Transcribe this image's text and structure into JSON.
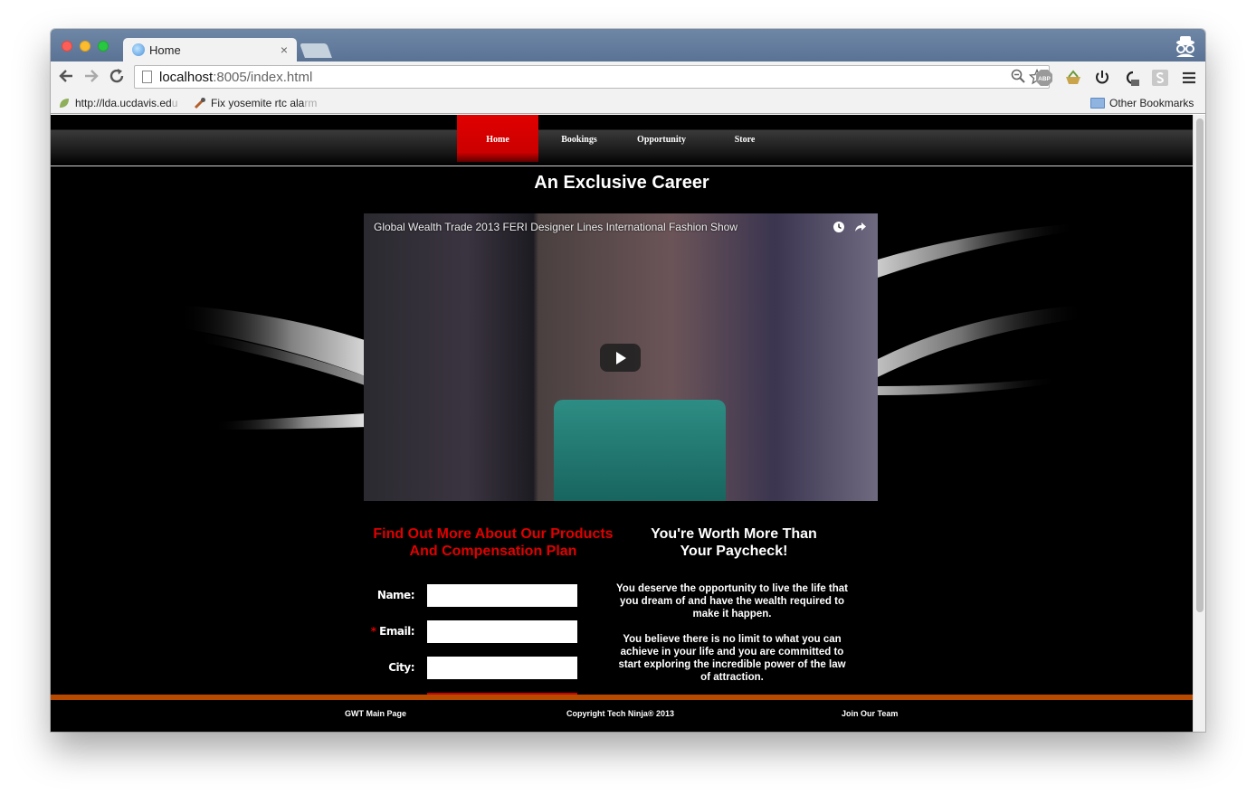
{
  "browser": {
    "tab_title": "Home",
    "tab_close": "×",
    "url_host": "localhost",
    "url_rest": ":8005/index.html",
    "bookmarks": [
      {
        "label": "http://lda.ucdavis.ed",
        "label_fade": "u"
      },
      {
        "label": "Fix yosemite rtc ala",
        "label_fade": "rm"
      }
    ],
    "other_bookmarks": "Other Bookmarks",
    "abp_label": "ABP"
  },
  "site": {
    "nav": [
      "Home",
      "Bookings",
      "Opportunity",
      "Store"
    ],
    "active_nav": "Home",
    "heading": "An Exclusive Career",
    "video": {
      "title": "Global Wealth Trade 2013 FERI Designer Lines International Fashion Show"
    },
    "left_heading_line1": "Find Out More About Our Products",
    "left_heading_line2": "And Compensation Plan",
    "right_heading_line1": "You're Worth More Than",
    "right_heading_line2": "Your Paycheck!",
    "form": {
      "name_label": "Name:",
      "email_label": "Email:",
      "required_mark": "*",
      "city_label": "City:"
    },
    "paragraph1": "You deserve the opportunity to live the life that you dream of and have the wealth required to make it happen.",
    "paragraph2": "You believe there is no limit to what you can achieve in your life and you are committed to start exploring the incredible power of the law of attraction.",
    "footer": {
      "left": "GWT Main Page",
      "center": "Copyright Tech Ninja® 2013",
      "right": "Join Our Team"
    }
  },
  "colors": {
    "accent_red": "#e00000",
    "footer_orange": "#b84a00",
    "chrome_blue": "#5a7395"
  }
}
